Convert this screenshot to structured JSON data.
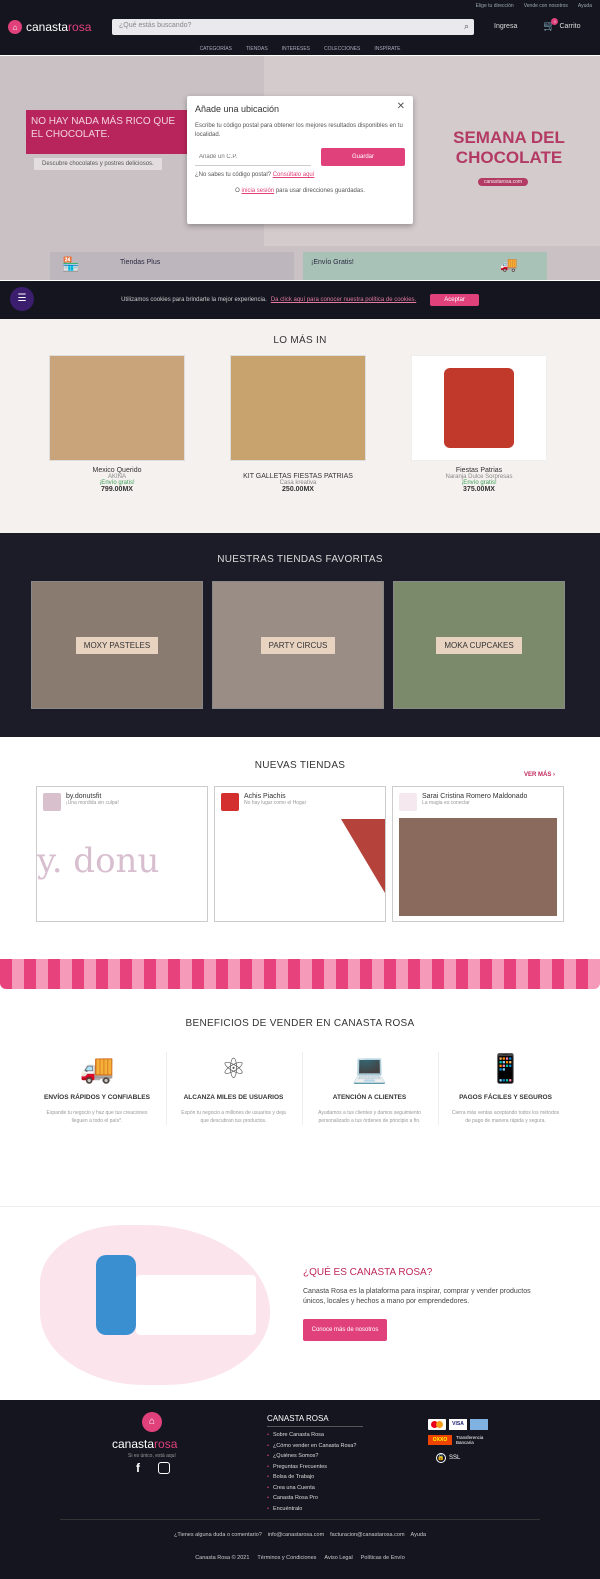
{
  "topbar": {
    "links": [
      "Elige tu dirección",
      "Vende con nosotros",
      "Ayuda"
    ]
  },
  "header": {
    "logo_text_a": "canasta",
    "logo_text_b": "rosa",
    "search_placeholder": "¿Qué estás buscando?",
    "login": "Ingresa",
    "cart": "Carrito",
    "cart_count": "0"
  },
  "nav": {
    "items": [
      "CATEGORÍAS",
      "TIENDAS",
      "INTERESES",
      "COLECCIONES",
      "INSPÍRATE"
    ]
  },
  "hero": {
    "title": "NO HAY NADA MÁS RICO QUE EL CHOCOLATE.",
    "subtitle": "Descubre chocolates y postres deliciosos.",
    "right_title": "SEMANA DEL CHOCOLATE",
    "right_url": "canastarosa.com",
    "promo_a": "Tiendas Plus",
    "promo_b": "¡Envío Gratis!"
  },
  "modal": {
    "title": "Añade una ubicación",
    "desc": "Escribe tu código postal para obtener los mejores resultados disponibles en tu localidad.",
    "cp_placeholder": "Añade un C.P.",
    "save": "Guardar",
    "no_cp": "¿No sabes tu código postal?",
    "consult": "Consúltalo aquí",
    "login_prefix": "O",
    "login_link": "inicia sesión",
    "login_suffix": "para usar direcciones guardadas."
  },
  "cookie": {
    "text": "Utilizamos cookies para brindarte la mejor experiencia.",
    "link": "Da click aquí para conocer nuestra política de cookies.",
    "accept": "Aceptar"
  },
  "lo_mas_in": {
    "title": "LO MÁS IN",
    "products": [
      {
        "name": "Mexico Querido",
        "store": "AKINA",
        "shipping": "¡Envío gratis!",
        "price": "799.00MX"
      },
      {
        "name": "KIT GALLETAS FIESTAS PATRIAS",
        "store": "Casa kreativa",
        "shipping": "",
        "price": "250.00MX"
      },
      {
        "name": "Fiestas Patrias",
        "store": "Naranja Dulce Sorpresas",
        "shipping": "¡Envío gratis!",
        "price": "375.00MX"
      }
    ]
  },
  "tiendas_favoritas": {
    "title": "NUESTRAS TIENDAS FAVORITAS",
    "stores": [
      "MOXY PASTELES",
      "PARTY CIRCUS",
      "MOKA CUPCAKES"
    ]
  },
  "nuevas_tiendas": {
    "title": "NUEVAS TIENDAS",
    "more": "VER MÁS",
    "stores": [
      {
        "name": "by.donutsfit",
        "tagline": "¡Una mordida sin culpa!",
        "image_text": "y. donu"
      },
      {
        "name": "Achis Piachis",
        "tagline": "No hay lugar como el Hogar"
      },
      {
        "name": "Sarai Cristina Romero Maldonado",
        "tagline": "La magia es conectar"
      }
    ]
  },
  "beneficios": {
    "title": "BENEFICIOS DE VENDER EN CANASTA ROSA",
    "items": [
      {
        "title": "ENVÍOS RÁPIDOS Y CONFIABLES",
        "text": "Expande tu negocio y haz que tus creaciones lleguen a todo el país*.",
        "icon": "truck-icon"
      },
      {
        "title": "ALCANZA MILES DE USUARIOS",
        "text": "Expón tu negocio a millones de usuarios y deja que descubran tus productos.",
        "icon": "network-icon"
      },
      {
        "title": "ATENCIÓN A CLIENTES",
        "text": "Ayudamos a tus clientes y damos seguimiento personalizado a tus órdenes de principio a fin.",
        "icon": "laptop-help-icon"
      },
      {
        "title": "PAGOS FÁCILES Y SEGUROS",
        "text": "Cierra más ventas aceptando todos los métodos de pago de manera rápida y segura.",
        "icon": "secure-phone-icon"
      }
    ]
  },
  "about": {
    "title": "¿QUÉ ES CANASTA ROSA?",
    "text": "Canasta Rosa es la plataforma para inspirar, comprar y vender productos únicos, locales y hechos a mano por emprendedores.",
    "button": "Conoce más de nosotros"
  },
  "footer": {
    "brand_a": "canasta",
    "brand_b": "rosa",
    "tagline": "Si es único, está aquí",
    "heading": "CANASTA ROSA",
    "links": [
      "Sobre Canasta Rosa",
      "¿Cómo vender en Canasta Rosa?",
      "¿Quiénes Somos?",
      "Preguntas Frecuentes",
      "Bolsa de Trabajo",
      "Crea una Cuenta",
      "Canasta Rosa Pro",
      "Encuéntralo"
    ],
    "payments": [
      "VISA",
      "OXXO",
      "Transferencia Bancaria"
    ],
    "ssl": "SSL",
    "contact_q": "¿Tienes alguna duda o comentario?",
    "email1": "info@canastarosa.com",
    "email2": "facturacion@canastarosa.com",
    "help": "Ayuda",
    "copyright": "Canasta Rosa © 2021",
    "terms": "Términos y Condiciones",
    "privacy": "Aviso Legal",
    "shipping": "Políticas de Envío"
  },
  "colors": {
    "brand": "#e0417a",
    "dark": "#14151f"
  }
}
